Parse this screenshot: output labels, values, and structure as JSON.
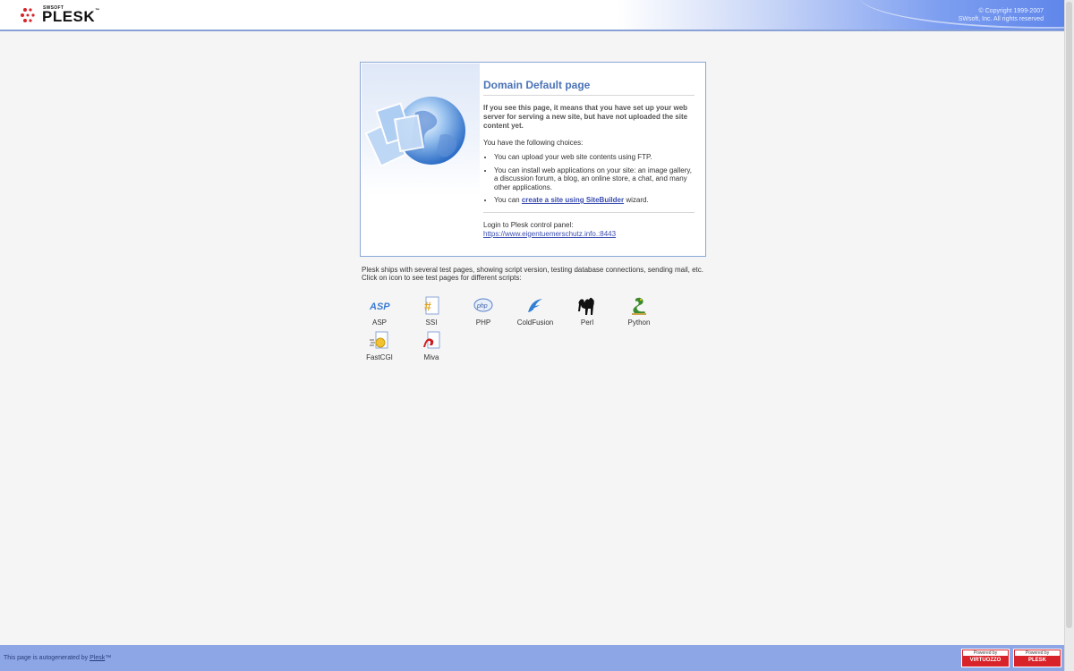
{
  "header": {
    "logo_small": "SWSOFT",
    "logo_main": "PLESK",
    "logo_tm": "™",
    "copyright_line1": "© Copyright 1999-2007",
    "copyright_line2": "SWsoft, Inc. All rights reserved"
  },
  "main": {
    "title": "Domain Default page",
    "intro": "If you see this page, it means that you have set up your web server for serving a new site, but have not uploaded the site content yet.",
    "choices_label": "You have the following choices:",
    "choices": [
      "You can upload your web site contents using FTP.",
      "You can install web applications on your site: an image gallery, a discussion forum, a blog, an online store, a chat, and many other applications."
    ],
    "choice3_prefix": "You can ",
    "choice3_link": "create a site using SiteBuilder",
    "choice3_suffix": " wizard.",
    "login_label": "Login to Plesk control panel:",
    "login_url": "https://www.eigentuemerschutz.info.:8443"
  },
  "note": "Plesk ships with several test pages, showing script version, testing database connections, sending mail, etc. Click on icon to see test pages for different scripts:",
  "scripts": [
    {
      "label": "ASP",
      "icon": "asp-icon"
    },
    {
      "label": "SSI",
      "icon": "ssi-icon"
    },
    {
      "label": "PHP",
      "icon": "php-icon"
    },
    {
      "label": "ColdFusion",
      "icon": "coldfusion-icon"
    },
    {
      "label": "Perl",
      "icon": "perl-camel-icon"
    },
    {
      "label": "Python",
      "icon": "python-snake-icon"
    },
    {
      "label": "FastCGI",
      "icon": "fastcgi-icon"
    },
    {
      "label": "Miva",
      "icon": "miva-icon"
    }
  ],
  "footer": {
    "prefix": "This page is autogenerated by ",
    "link": "Plesk",
    "suffix": "™",
    "badge1_top": "Powered by",
    "badge1_bottom": "VIRTUOZZO",
    "badge2_top": "Powered by",
    "badge2_bottom": "PLESK"
  },
  "colors": {
    "accent": "#4a73b7",
    "header_blue": "#5f86ea",
    "footer_blue": "#8da6e6",
    "badge_red": "#d8232a"
  }
}
